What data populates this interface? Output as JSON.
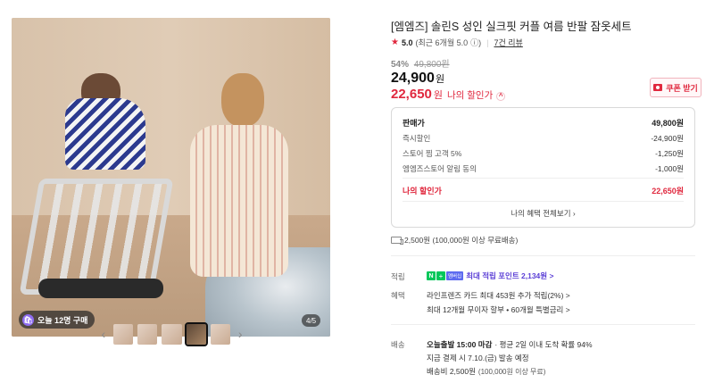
{
  "gallery": {
    "badge_text": "오늘 12명 구매",
    "counter": "4/5",
    "prev_icon": "chevron-left-icon",
    "next_icon": "chevron-right-icon",
    "thumb_count": 5,
    "active_thumb": 4
  },
  "product": {
    "title": "[엠엠즈] 솔린S 성인 실크핏 커플 여름 반팔 잠옷세트",
    "rating_score": "5.0",
    "rating_recent": "(최근 6개월 5.0",
    "rating_info": "ⓘ)",
    "review_link": "7건 리뷰",
    "discount_pct": "54%",
    "original_price": "49,800원",
    "price": "24,900",
    "price_unit": "원",
    "my_price": "22,650",
    "my_price_unit": "원",
    "my_price_label": "나의 할인가",
    "coupon_button": "쿠폰 받기"
  },
  "breakdown": {
    "rows": [
      {
        "label": "판매가",
        "value": "49,800원"
      },
      {
        "label": "즉시할인",
        "value": "-24,900원"
      },
      {
        "label": "스토어 찜 고객 5%",
        "value": "-1,250원"
      },
      {
        "label": "엠엠즈스토어 알림 동의",
        "value": "-1,000원"
      }
    ],
    "mine_label": "나의 할인가",
    "mine_value": "22,650원",
    "see_all": "나의 혜택 전체보기"
  },
  "shipping": {
    "text": "2,500원 (100,000원 이상 무료배송)"
  },
  "points": {
    "label": "적립",
    "npay_n": "N",
    "npay_plus": "+",
    "npay_member": "멤버십",
    "text": "최대 적립 포인트 2,134원 >"
  },
  "benefit": {
    "label": "혜택",
    "line1": "라인프렌즈 카드 최대 453원 추가 적립(2%) >",
    "line2": "최대 12개월 무이자 할부 • 60개월 특별금리 >"
  },
  "delivery": {
    "label": "배송",
    "line1_bold": "오늘출발 15:00 마감",
    "line1_rest": "· 평균 2일 이내 도착 확률 94%",
    "line2": "지금 결제 시 7.10.(금) 발송 예정",
    "line3_main": "배송비 2,500원",
    "line3_small": "(100,000원 이상 무료)"
  },
  "colors": {
    "accent_red": "#e0283e",
    "point_purple": "#5b3fd6",
    "npay_green": "#03c75a"
  }
}
